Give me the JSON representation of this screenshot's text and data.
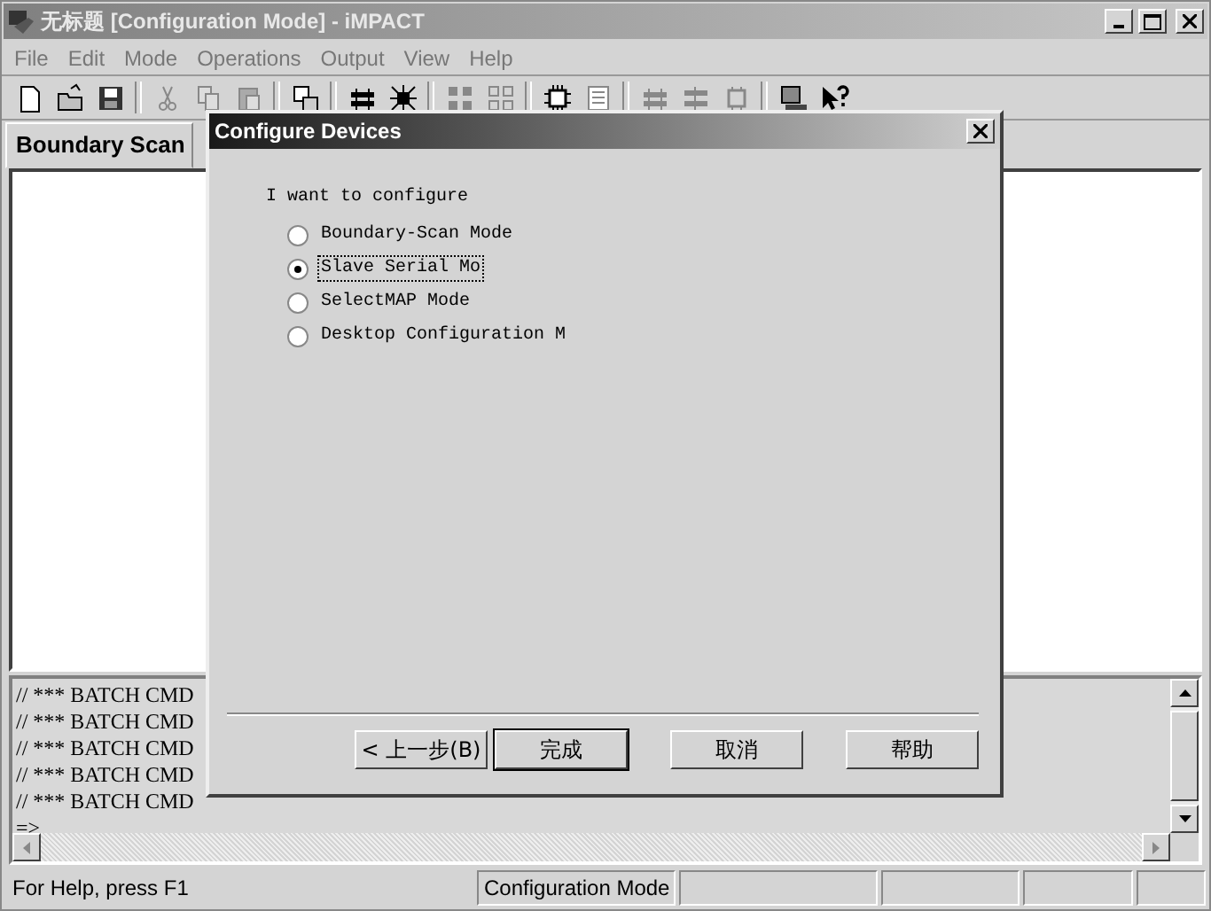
{
  "window": {
    "title": "无标题 [Configuration Mode] - iMPACT"
  },
  "menu": [
    "File",
    "Edit",
    "Mode",
    "Operations",
    "Output",
    "View",
    "Help"
  ],
  "tabs": [
    {
      "label": "Boundary Scan",
      "selected": true
    }
  ],
  "log": {
    "lines": [
      "// *** BATCH CMD",
      "// *** BATCH CMD",
      "// *** BATCH CMD",
      "// *** BATCH CMD",
      "// *** BATCH CMD",
      "=>"
    ]
  },
  "status_bar": [
    "For Help, press F1",
    "Configuration Mode"
  ],
  "dialog": {
    "title": "Configure Devices",
    "prompt": "I want to configure",
    "options": [
      {
        "label": "Boundary-Scan Mode",
        "selected": false
      },
      {
        "label": "Slave Serial Mo",
        "selected": true
      },
      {
        "label": "SelectMAP Mode",
        "selected": false
      },
      {
        "label": "Desktop Configuration M",
        "selected": false
      }
    ],
    "buttons": [
      {
        "label": "< 上一步(B)",
        "default": false
      },
      {
        "label": "完成",
        "default": true
      },
      {
        "label": "取消",
        "default": false
      },
      {
        "label": "帮助",
        "default": false
      }
    ]
  }
}
